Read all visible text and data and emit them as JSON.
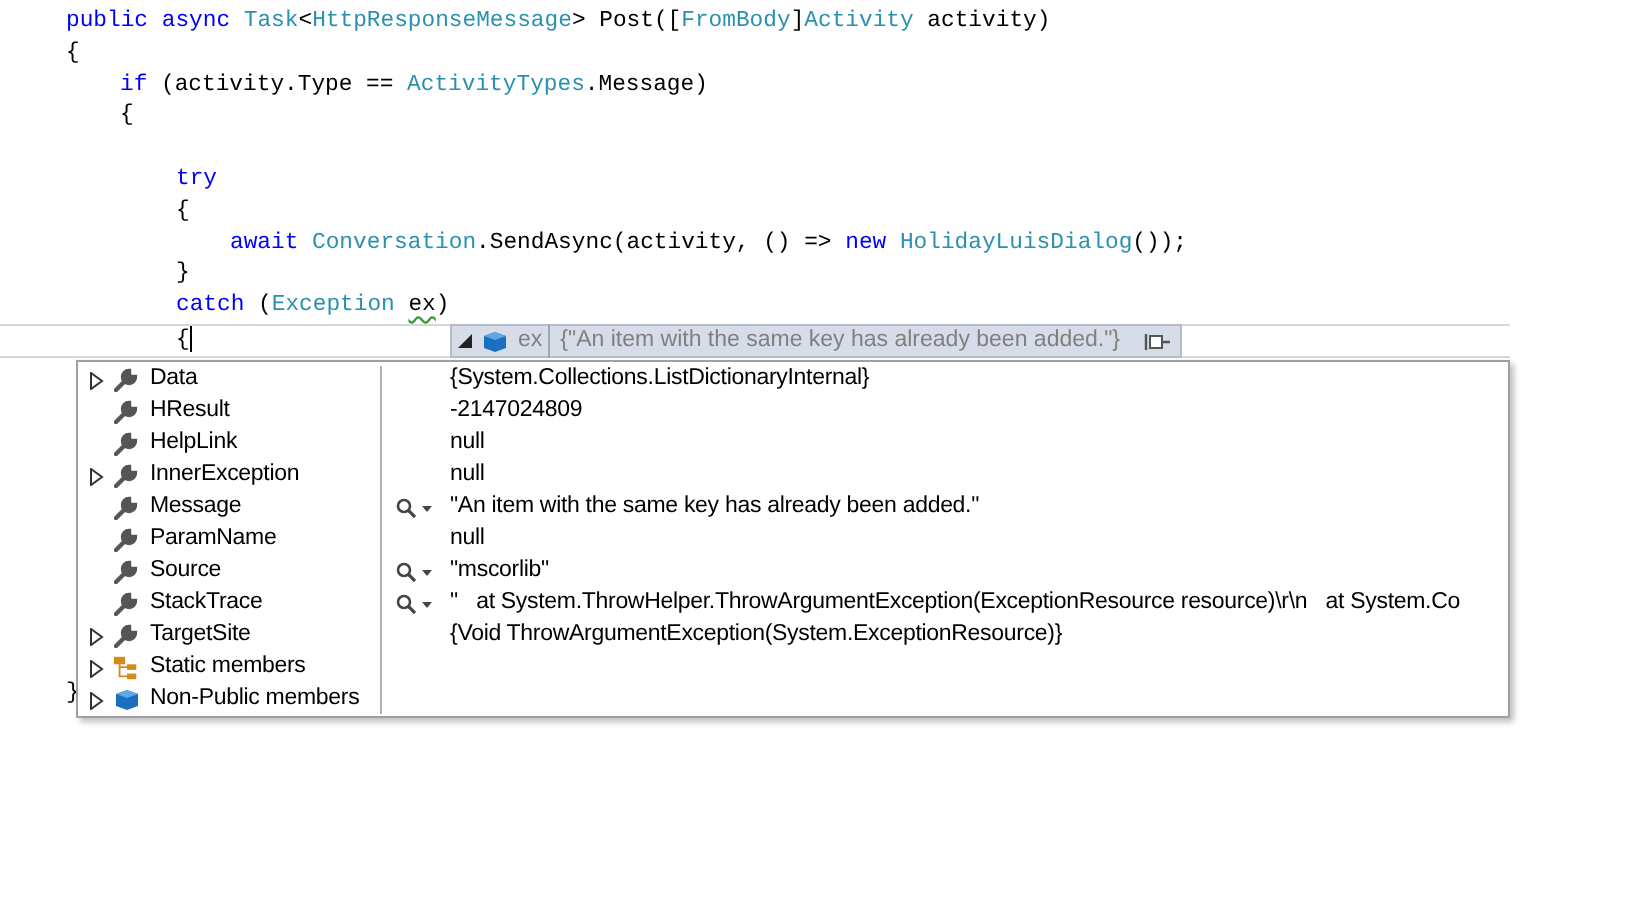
{
  "code": {
    "lines": [
      {
        "tokens": [
          {
            "text": "public ",
            "kind": "keyword"
          },
          {
            "text": "async ",
            "kind": "keyword"
          },
          {
            "text": "Task",
            "kind": "type"
          },
          {
            "text": "<",
            "kind": "plain"
          },
          {
            "text": "HttpResponseMessage",
            "kind": "type"
          },
          {
            "text": "> Post([",
            "kind": "plain"
          },
          {
            "text": "FromBody",
            "kind": "type"
          },
          {
            "text": "]",
            "kind": "plain"
          },
          {
            "text": "Activity",
            "kind": "type"
          },
          {
            "text": " activity)",
            "kind": "plain"
          }
        ]
      },
      {
        "tokens": [
          {
            "text": "{",
            "kind": "plain"
          }
        ],
        "children": [
          {
            "tokens": [
              {
                "text": "if",
                "kind": "keyword"
              },
              {
                "text": " (activity.Type == ",
                "kind": "plain"
              },
              {
                "text": "ActivityTypes",
                "kind": "type"
              },
              {
                "text": ".Message)",
                "kind": "plain"
              }
            ]
          },
          {
            "tokens": [
              {
                "text": "{",
                "kind": "plain"
              }
            ],
            "children": [
              {
                "blank_before": true,
                "tokens": [
                  {
                    "text": "try",
                    "kind": "keyword"
                  }
                ]
              },
              {
                "tokens": [
                  {
                    "text": "{",
                    "kind": "plain"
                  }
                ],
                "children": [
                  {
                    "tokens": [
                      {
                        "text": "await ",
                        "kind": "keyword"
                      },
                      {
                        "text": "Conversation",
                        "kind": "type"
                      },
                      {
                        "text": ".SendAsync(activity, () => ",
                        "kind": "plain"
                      },
                      {
                        "text": "new ",
                        "kind": "keyword"
                      },
                      {
                        "text": "HolidayLuisDialog",
                        "kind": "type"
                      },
                      {
                        "text": "());",
                        "kind": "plain"
                      }
                    ]
                  }
                ]
              },
              {
                "tokens": [
                  {
                    "text": "}",
                    "kind": "plain"
                  }
                ]
              },
              {
                "tokens": [
                  {
                    "text": "catch",
                    "kind": "keyword"
                  },
                  {
                    "text": " (",
                    "kind": "plain"
                  },
                  {
                    "text": "Exception ",
                    "kind": "type"
                  },
                  {
                    "text": "ex",
                    "kind": "warning"
                  },
                  {
                    "text": ")",
                    "kind": "plain"
                  }
                ]
              },
              {
                "current": true,
                "tokens": [
                  {
                    "text": "{",
                    "kind": "plain"
                  }
                ]
              }
            ]
          }
        ]
      }
    ],
    "closing_line": "}"
  },
  "datatip": {
    "expanded": true,
    "name": "ex",
    "value": "{\"An item with the same key has already been added.\"}",
    "members": [
      {
        "name": "Data",
        "kind": "property",
        "expandable": true,
        "visualizer": false,
        "value": "{System.Collections.ListDictionaryInternal}"
      },
      {
        "name": "HResult",
        "kind": "property",
        "expandable": false,
        "visualizer": false,
        "value": "-2147024809"
      },
      {
        "name": "HelpLink",
        "kind": "property",
        "expandable": false,
        "visualizer": false,
        "value": "null"
      },
      {
        "name": "InnerException",
        "kind": "property",
        "expandable": true,
        "visualizer": false,
        "value": "null"
      },
      {
        "name": "Message",
        "kind": "property",
        "expandable": false,
        "visualizer": true,
        "value": "\"An item with the same key has already been added.\""
      },
      {
        "name": "ParamName",
        "kind": "property",
        "expandable": false,
        "visualizer": false,
        "value": "null"
      },
      {
        "name": "Source",
        "kind": "property",
        "expandable": false,
        "visualizer": true,
        "value": "\"mscorlib\""
      },
      {
        "name": "StackTrace",
        "kind": "property",
        "expandable": false,
        "visualizer": true,
        "value": "\"   at System.ThrowHelper.ThrowArgumentException(ExceptionResource resource)\\r\\n   at System.Co"
      },
      {
        "name": "TargetSite",
        "kind": "property",
        "expandable": true,
        "visualizer": false,
        "value": "{Void ThrowArgumentException(System.ExceptionResource)}"
      },
      {
        "name": "Static members",
        "kind": "static",
        "expandable": true,
        "visualizer": false
      },
      {
        "name": "Non-Public members",
        "kind": "nonpublic",
        "expandable": true,
        "visualizer": false
      }
    ]
  }
}
